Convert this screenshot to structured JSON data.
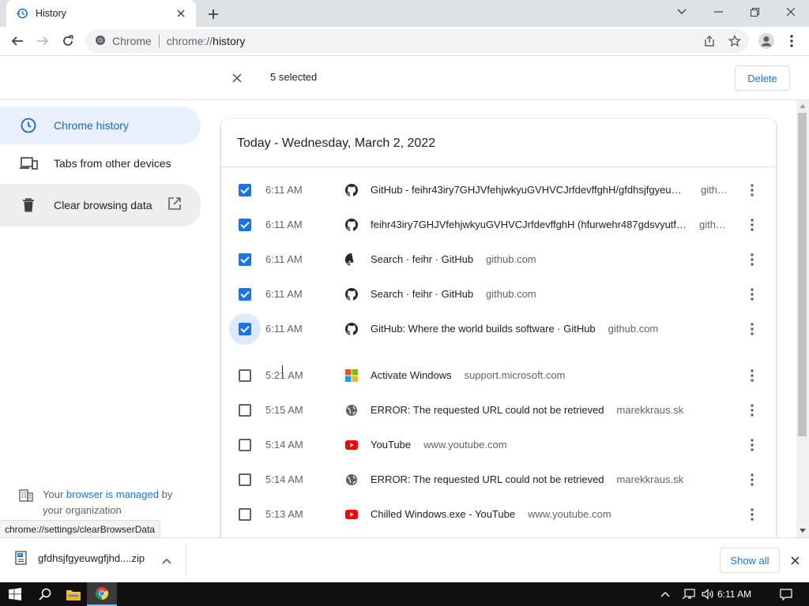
{
  "tab": {
    "title": "History"
  },
  "omnibox": {
    "site_label": "Chrome",
    "url_scheme": "chrome://",
    "url_path": "history"
  },
  "selection": {
    "count_label": "5 selected",
    "delete_label": "Delete"
  },
  "sidebar": {
    "items": [
      {
        "label": "Chrome history",
        "icon": "clock-icon"
      },
      {
        "label": "Tabs from other devices",
        "icon": "devices-icon"
      },
      {
        "label": "Clear browsing data",
        "icon": "trash-icon"
      }
    ],
    "managed_text_1": "Your",
    "managed_link": "browser is managed",
    "managed_text_2": "by your organization",
    "status_url": "chrome://settings/clearBrowserData"
  },
  "history": {
    "date_heading": "Today - Wednesday, March 2, 2022",
    "rows": [
      {
        "checked": true,
        "time": "6:11 AM",
        "favicon": "github-icon",
        "title": "GitHub - feihr43iry7GHJVfehjwkyuGVHVCJrfdevffghH/gfdhsjfgyeuw…",
        "domain": "gith…"
      },
      {
        "checked": true,
        "time": "6:11 AM",
        "favicon": "github-icon",
        "title": "feihr43iry7GHJVfehjwkyuGVHVCJrfdevffghH (hfurwehr487gdsvyutf…",
        "domain": "gith…"
      },
      {
        "checked": true,
        "time": "6:11 AM",
        "favicon": "github-icon",
        "title": "Search · feihr · GitHub",
        "domain": "github.com"
      },
      {
        "checked": true,
        "time": "6:11 AM",
        "favicon": "github-icon",
        "title": "Search · feihr · GitHub",
        "domain": "github.com"
      },
      {
        "checked": true,
        "time": "6:11 AM",
        "favicon": "github-icon",
        "title": "GitHub: Where the world builds software · GitHub",
        "domain": "github.com"
      },
      {
        "checked": false,
        "time": "5:21 AM",
        "favicon": "microsoft-icon",
        "title": "Activate Windows",
        "domain": "support.microsoft.com"
      },
      {
        "checked": false,
        "time": "5:15 AM",
        "favicon": "globe-icon",
        "title": "ERROR: The requested URL could not be retrieved",
        "domain": "marekkraus.sk"
      },
      {
        "checked": false,
        "time": "5:14 AM",
        "favicon": "youtube-icon",
        "title": "YouTube",
        "domain": "www.youtube.com"
      },
      {
        "checked": false,
        "time": "5:14 AM",
        "favicon": "globe-icon",
        "title": "ERROR: The requested URL could not be retrieved",
        "domain": "marekkraus.sk"
      },
      {
        "checked": false,
        "time": "5:13 AM",
        "favicon": "youtube-icon",
        "title": "Chilled Windows.exe - YouTube",
        "domain": "www.youtube.com"
      }
    ]
  },
  "downloads": {
    "file_name": "gfdhsjfgyeuwgfjhd....zip",
    "show_all_label": "Show all"
  },
  "taskbar": {
    "time": "6:11 AM"
  },
  "colors": {
    "accent": "#1a73e8",
    "active_bg": "#e8f0fe"
  }
}
